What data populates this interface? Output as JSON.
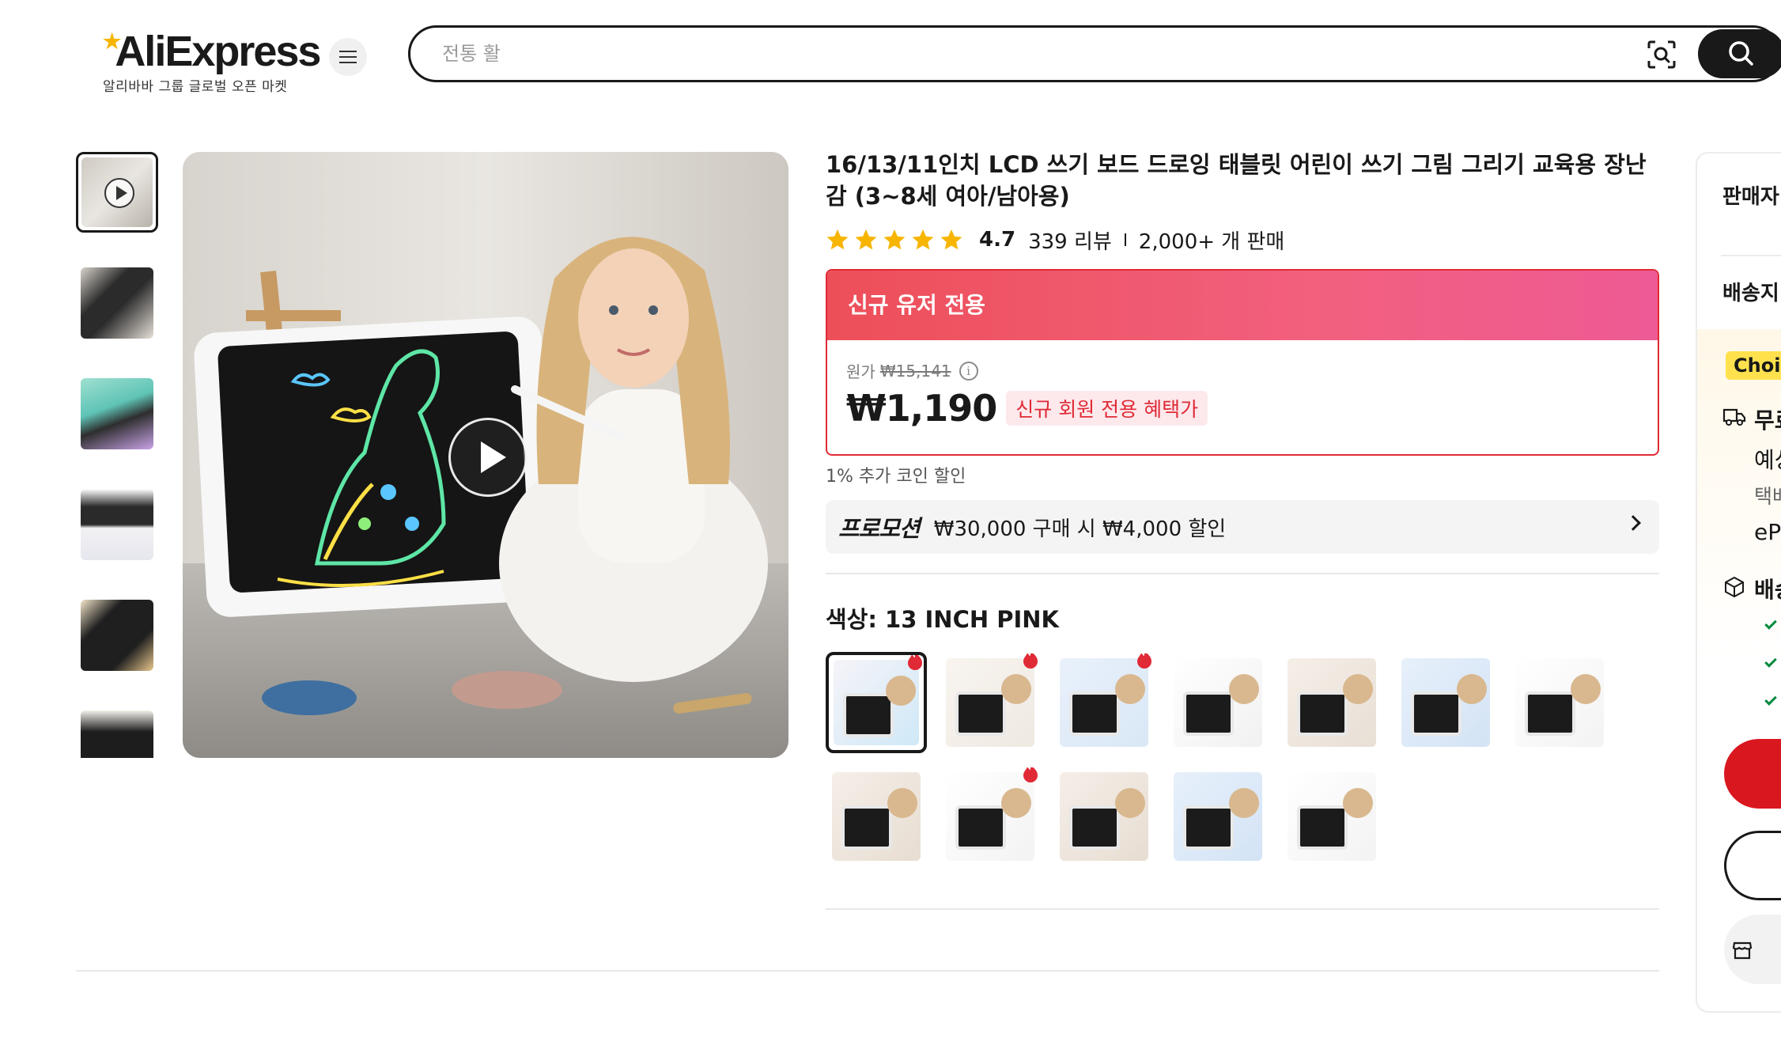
{
  "header": {
    "logo_text": "AliExpress",
    "logo_tagline": "알리바바 그룹 글로벌 오픈 마켓",
    "search_placeholder": "전통 활"
  },
  "product": {
    "title": "16/13/11인치 LCD 쓰기 보드 드로잉 태블릿 어린이 쓰기 그림 그리기 교육용 장난감 (3~8세 여아/남아용)",
    "rating": "4.7",
    "reviews": "339 리뷰",
    "sold": "2,000+ 개 판매",
    "star_count": 5
  },
  "deal": {
    "banner": "신규 유저 전용",
    "original_label": "원가",
    "original_price": "₩15,141",
    "info_icon": "i",
    "price": "₩1,190",
    "benefit": "신규 회원 전용 혜택가"
  },
  "coin_discount": "1% 추가 코인 할인",
  "promotion": {
    "badge": "프로모션",
    "text": "₩30,000 구매 시 ₩4,000 할인"
  },
  "color": {
    "label": "색상: 13 INCH PINK",
    "option_count": 12,
    "selected_index": 0,
    "hot_indices": [
      0,
      1,
      2,
      8
    ]
  },
  "sidebar": {
    "seller_heading": "판매자",
    "shipping_heading": "배송지",
    "choice_tag": "Choic",
    "free_label": "무료",
    "estimate": "예상",
    "courier": "택배",
    "carrier": "eP",
    "delivery_label": "배송"
  },
  "colors": {
    "accent_red": "#e02a36",
    "deal_gradient_start": "#ed4f58",
    "deal_gradient_end": "#ee5a94",
    "star_yellow": "#f7b500",
    "choice_yellow": "#ffe14d",
    "delivery_green": "#018a3d"
  },
  "icons": {
    "menu": "hamburger-icon",
    "camera_search": "image-search-icon",
    "search": "search-icon",
    "play": "play-icon",
    "hot": "fire-icon",
    "chevron": "chevron-right-icon"
  }
}
